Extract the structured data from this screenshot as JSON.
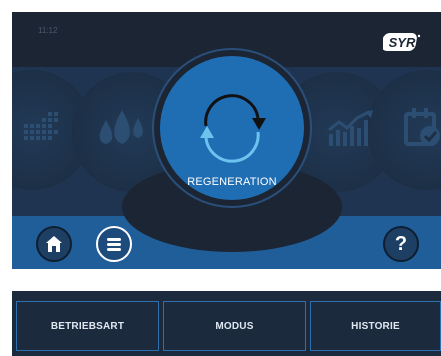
{
  "header": {
    "time": "11:12",
    "logo_text": "SYR"
  },
  "main": {
    "label": "REGENERATION",
    "icon": "regeneration-cycle-icon"
  },
  "carousel": {
    "items": [
      {
        "icon": "calendar-grid-icon"
      },
      {
        "icon": "water-drops-icon"
      },
      {
        "icon": "chart-trend-icon"
      },
      {
        "icon": "calendar-check-icon"
      }
    ]
  },
  "bottom": {
    "home_icon": "home-icon",
    "menu_icon": "menu-icon",
    "help_label": "?"
  },
  "tabs": [
    {
      "label": "BETRIEBSART"
    },
    {
      "label": "MODUS"
    },
    {
      "label": "HISTORIE"
    }
  ],
  "colors": {
    "background": "#1b2533",
    "accent": "#1f6db3",
    "bottom_bar": "#1f5e98",
    "cycle_dark": "#111111",
    "cycle_light": "#6bc3ee"
  }
}
